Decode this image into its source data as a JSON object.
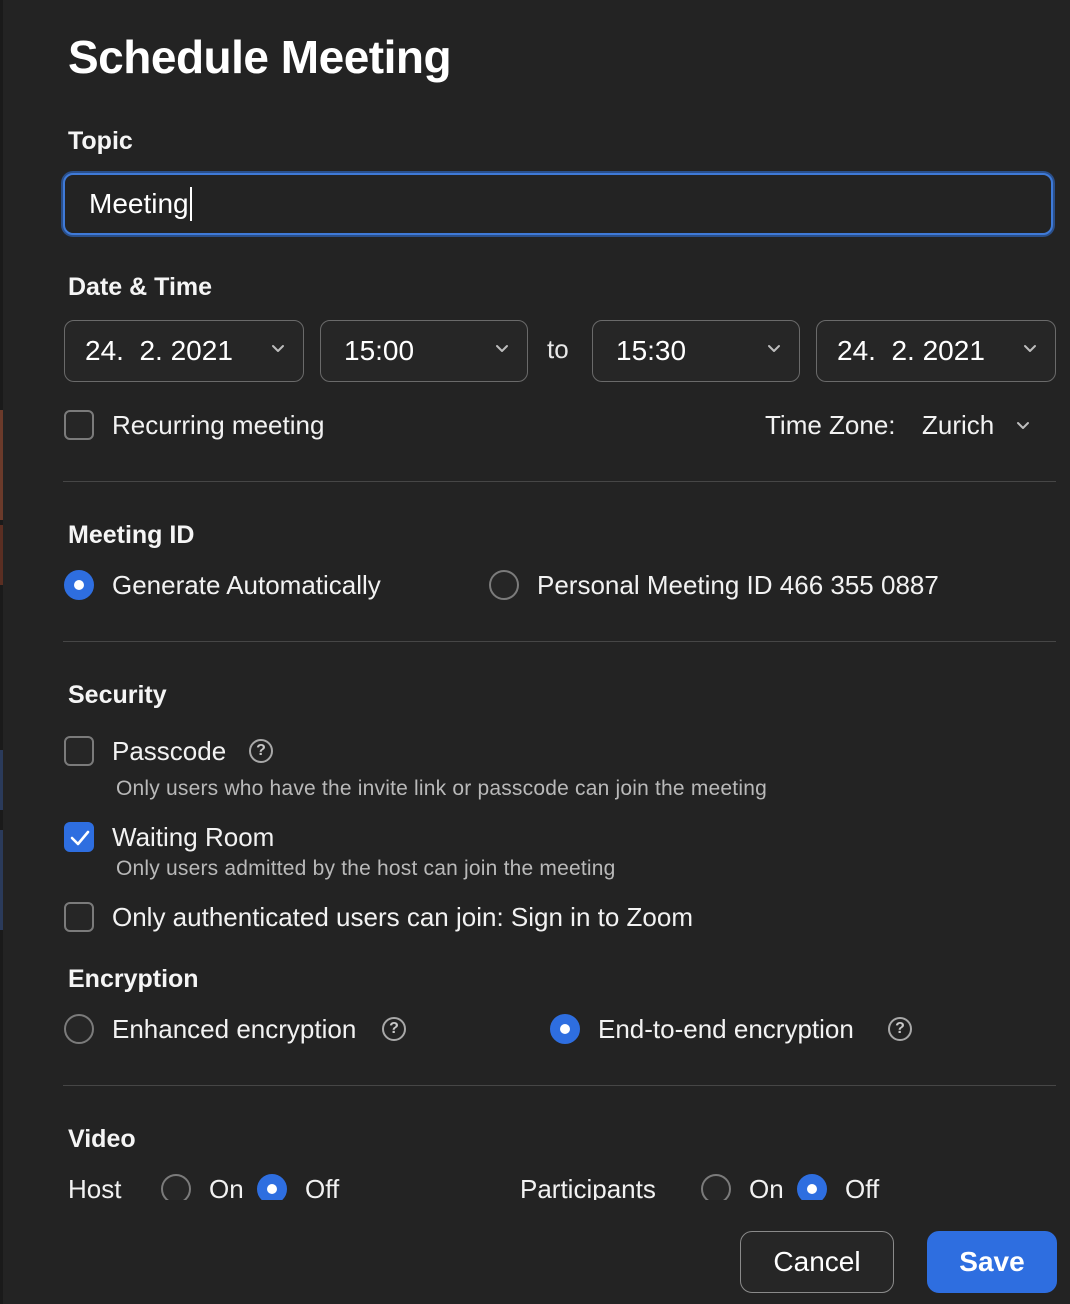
{
  "title": "Schedule Meeting",
  "topic": {
    "label": "Topic",
    "value": "Meeting"
  },
  "datetime": {
    "label": "Date & Time",
    "start_date": "24.  2. 2021",
    "start_time": "15:00",
    "to_label": "to",
    "end_time": "15:30",
    "end_date": "24.  2. 2021",
    "recurring_label": "Recurring meeting",
    "recurring_checked": false,
    "timezone_label": "Time Zone:",
    "timezone_value": "Zurich"
  },
  "meeting_id": {
    "label": "Meeting ID",
    "options": [
      {
        "label": "Generate Automatically",
        "selected": true
      },
      {
        "label": "Personal Meeting ID 466 355 0887",
        "selected": false
      }
    ]
  },
  "security": {
    "label": "Security",
    "passcode_label": "Passcode",
    "passcode_checked": false,
    "passcode_help": "Only users who have the invite link or passcode can join the meeting",
    "waiting_room_label": "Waiting Room",
    "waiting_room_checked": true,
    "waiting_room_help": "Only users admitted by the host can join the meeting",
    "auth_label": "Only authenticated users can join: Sign in to Zoom",
    "auth_checked": false
  },
  "encryption": {
    "label": "Encryption",
    "enhanced_label": "Enhanced encryption",
    "enhanced_selected": false,
    "e2e_label": "End-to-end encryption",
    "e2e_selected": true
  },
  "video": {
    "label": "Video",
    "host_label": "Host",
    "participants_label": "Participants",
    "on_label": "On",
    "off_label": "Off",
    "host_value": "Off",
    "participants_value": "Off"
  },
  "buttons": {
    "cancel": "Cancel",
    "save": "Save"
  },
  "colors": {
    "background": "#232323",
    "accent": "#2e6ee0",
    "text": "#f2f2f2",
    "muted_text": "#b9b9b9"
  },
  "icons": {
    "dropdown": "chevron-down-icon",
    "help": "help-circle-icon",
    "check": "checkmark-icon"
  }
}
